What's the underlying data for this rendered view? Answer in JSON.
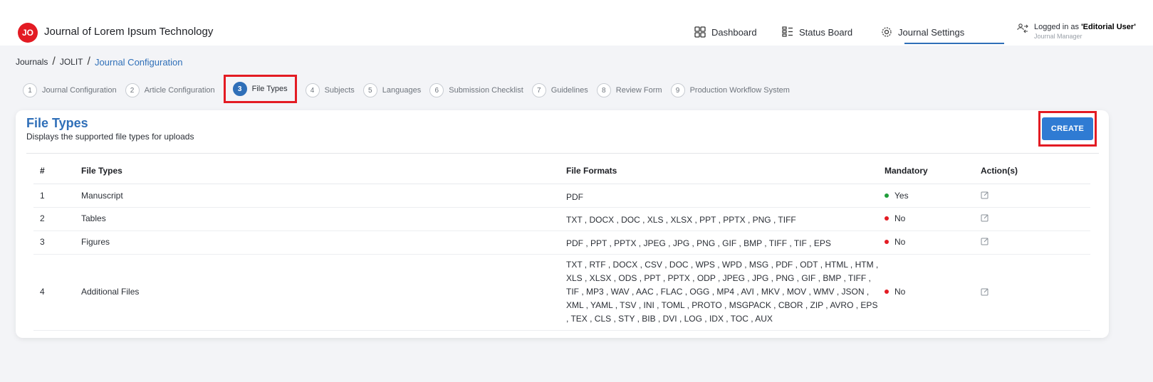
{
  "header": {
    "logo_initials": "JO",
    "app_title": "Journal of Lorem Ipsum Technology",
    "nav": [
      {
        "label": "Dashboard",
        "icon": "grid-icon"
      },
      {
        "label": "Status Board",
        "icon": "board-icon"
      },
      {
        "label": "Journal Settings",
        "icon": "gear-icon"
      }
    ],
    "user": {
      "prefix": "Logged in as",
      "name": "'Editorial User'",
      "role": "Journal Manager"
    }
  },
  "breadcrumb": {
    "items": [
      "Journals",
      "JOLIT"
    ],
    "current": "Journal Configuration"
  },
  "steps": [
    {
      "num": "1",
      "label": "Journal Configuration"
    },
    {
      "num": "2",
      "label": "Article Configuration"
    },
    {
      "num": "3",
      "label": "File Types"
    },
    {
      "num": "4",
      "label": "Subjects"
    },
    {
      "num": "5",
      "label": "Languages"
    },
    {
      "num": "6",
      "label": "Submission Checklist"
    },
    {
      "num": "7",
      "label": "Guidelines"
    },
    {
      "num": "8",
      "label": "Review Form"
    },
    {
      "num": "9",
      "label": "Production Workflow System"
    }
  ],
  "card": {
    "title": "File Types",
    "subtitle": "Displays the supported file types for uploads",
    "create_label": "CREATE"
  },
  "table": {
    "headers": {
      "num": "#",
      "type": "File Types",
      "formats": "File Formats",
      "mandatory": "Mandatory",
      "actions": "Action(s)"
    },
    "rows": [
      {
        "num": "1",
        "type": "Manuscript",
        "formats": "PDF",
        "mandatory": "Yes",
        "status_color": "#1f9d3a"
      },
      {
        "num": "2",
        "type": "Tables",
        "formats": "TXT , DOCX , DOC , XLS , XLSX , PPT , PPTX , PNG , TIFF",
        "mandatory": "No",
        "status_color": "#e31b23"
      },
      {
        "num": "3",
        "type": "Figures",
        "formats": "PDF , PPT , PPTX , JPEG , JPG , PNG , GIF , BMP , TIFF , TIF , EPS",
        "mandatory": "No",
        "status_color": "#e31b23"
      },
      {
        "num": "4",
        "type": "Additional Files",
        "formats": "TXT , RTF , DOCX , CSV , DOC , WPS , WPD , MSG , PDF , ODT , HTML , HTM , XLS , XLSX , ODS , PPT , PPTX , ODP , JPEG , JPG , PNG , GIF , BMP , TIFF , TIF , MP3 , WAV , AAC , FLAC , OGG , MP4 , AVI , MKV , MOV , WMV , JSON , XML , YAML , TSV , INI , TOML , PROTO , MSGPACK , CBOR , ZIP , AVRO , EPS , TEX , CLS , STY , BIB , DVI , LOG , IDX , TOC , AUX",
        "mandatory": "No",
        "status_color": "#e31b23"
      }
    ]
  },
  "colors": {
    "accent": "#2f6fb8",
    "brand_red": "#e31b23",
    "button": "#2f7bd3"
  }
}
